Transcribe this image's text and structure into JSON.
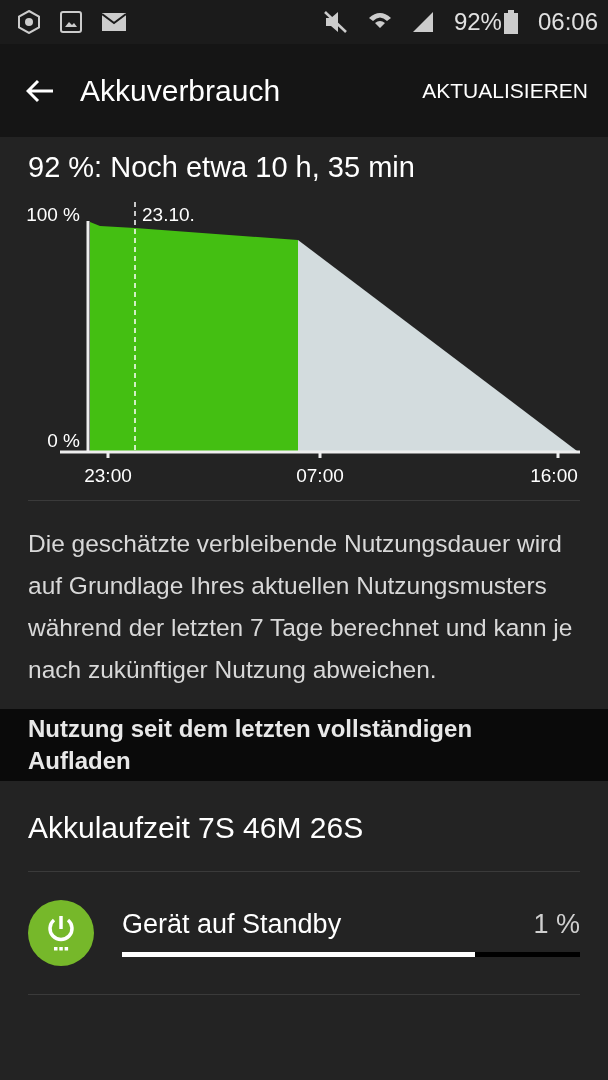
{
  "status_bar": {
    "battery": "92%",
    "time": "06:06"
  },
  "toolbar": {
    "title": "Akkuverbrauch",
    "action": "AKTUALISIEREN"
  },
  "summary": "92 %: Noch etwa 10 h, 35 min",
  "chart": {
    "y_labels": [
      "100 %",
      "0 %"
    ],
    "marker_label": "23.10.",
    "x_labels": [
      "23:00",
      "07:00",
      "16:00"
    ]
  },
  "description": "Die geschätzte verbleibende Nutzungsdauer wird auf Grundlage Ihres aktuellen Nutzungsmusters während der letzten 7 Tage berechnet und kann je nach zukünftiger Nutzung abweichen.",
  "section_header": "Nutzung seit dem letzten vollständigen Aufladen",
  "battery_time": "Akkulaufzeit 7S 46M 26S",
  "usage": [
    {
      "name": "Gerät auf Standby",
      "percent": "1 %",
      "level": 0.77
    }
  ]
}
